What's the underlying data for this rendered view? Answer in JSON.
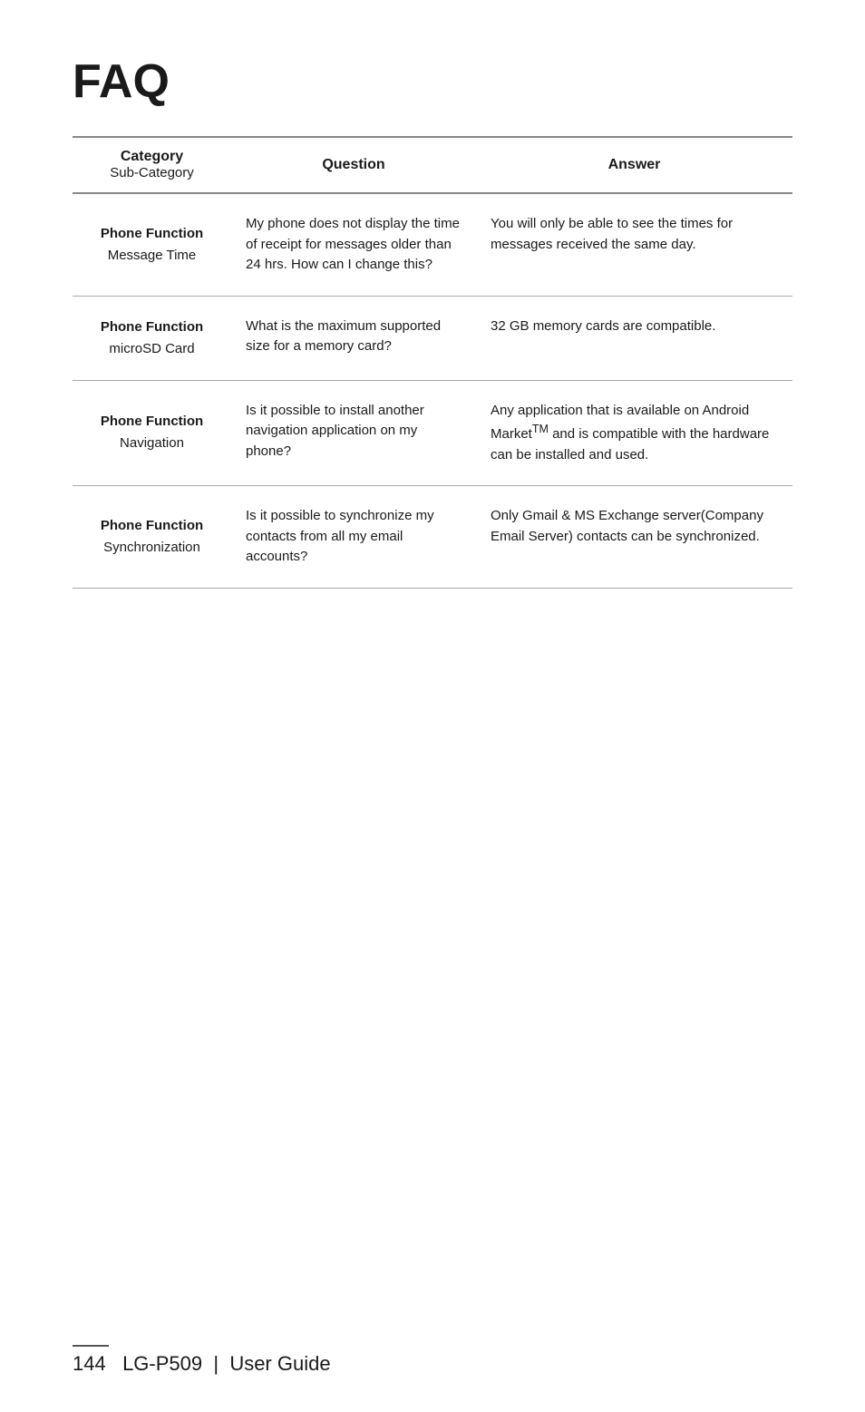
{
  "page": {
    "title": "FAQ",
    "footer": {
      "page_number": "144",
      "device": "LG-P509",
      "separator": "|",
      "guide": "User Guide"
    }
  },
  "table": {
    "headers": {
      "category_main": "Category",
      "category_sub": "Sub-Category",
      "question": "Question",
      "answer": "Answer"
    },
    "rows": [
      {
        "category_main": "Phone Function",
        "category_sub": "Message Time",
        "question": "My phone does not display the time of receipt for messages older than 24 hrs. How can I change this?",
        "answer": "You will only be able to see the times for messages received the same day."
      },
      {
        "category_main": "Phone Function",
        "category_sub": "microSD Card",
        "question": "What is the maximum supported size for a memory card?",
        "answer": "32 GB memory cards are compatible."
      },
      {
        "category_main": "Phone Function",
        "category_sub": "Navigation",
        "question": "Is it possible to install another navigation application on my phone?",
        "answer": "Any application that is available on Android Market™ and is compatible with the hardware can be installed and used."
      },
      {
        "category_main": "Phone Function",
        "category_sub": "Synchronization",
        "question": "Is it possible to synchronize my contacts from all my email accounts?",
        "answer": "Only Gmail & MS Exchange server(Company Email Server) contacts can be synchronized."
      }
    ]
  }
}
